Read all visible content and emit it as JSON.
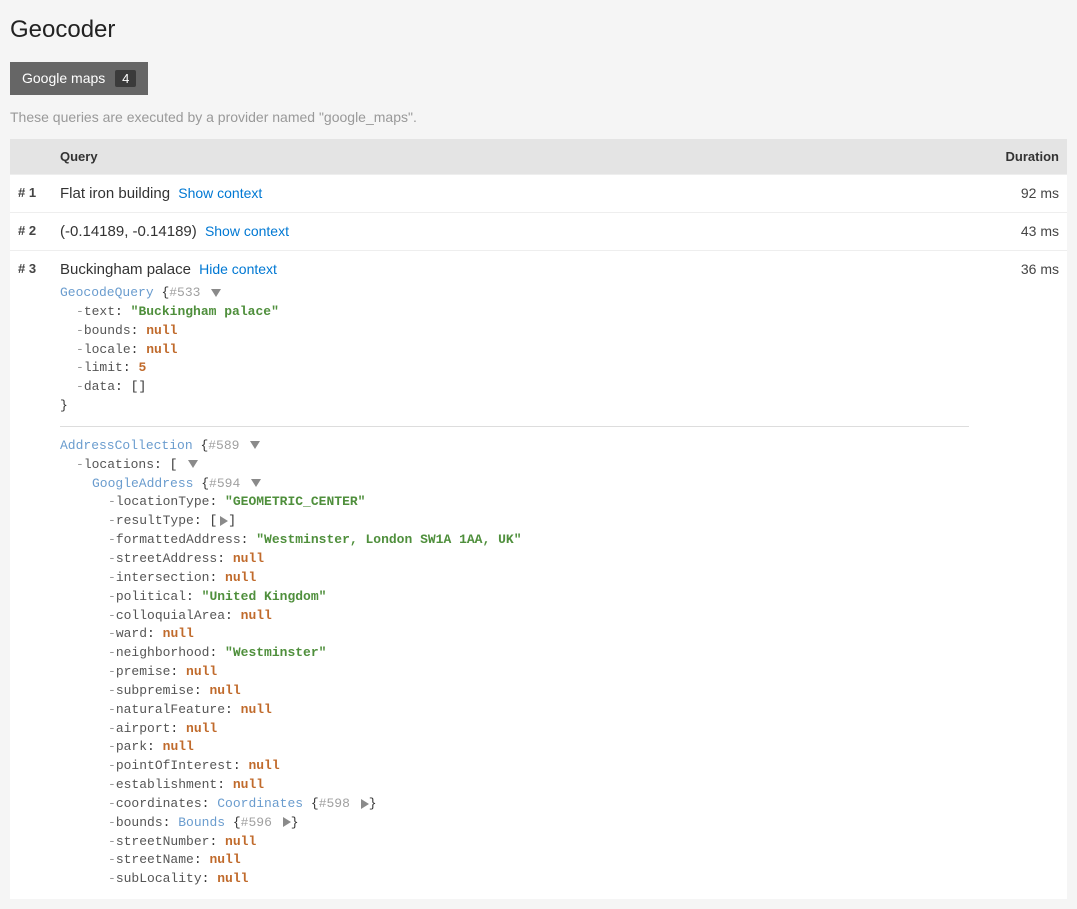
{
  "title": "Geocoder",
  "tab": {
    "label": "Google maps",
    "badge": "4"
  },
  "helper": "These queries are executed by a provider named \"google_maps\".",
  "table": {
    "headers": {
      "query": "Query",
      "duration": "Duration"
    },
    "rows": [
      {
        "idx": "# 1",
        "query": "Flat iron building",
        "toggle": "Show context",
        "duration": "92 ms"
      },
      {
        "idx": "# 2",
        "query": "(-0.14189, -0.14189)",
        "toggle": "Show context",
        "duration": "43 ms"
      },
      {
        "idx": "# 3",
        "query": "Buckingham palace",
        "toggle": "Hide context",
        "duration": "36 ms"
      }
    ]
  },
  "dump": {
    "query": {
      "class": "GeocodeQuery",
      "ref": "#533",
      "fields": {
        "text": "\"Buckingham palace\"",
        "bounds": "null",
        "locale": "null",
        "limit": "5",
        "data": "[]"
      }
    },
    "result": {
      "class": "AddressCollection",
      "ref": "#589",
      "locationsKey": "locations",
      "address": {
        "class": "GoogleAddress",
        "ref": "#594",
        "fields": {
          "locationType": {
            "label": "locationType",
            "val": "\"GEOMETRIC_CENTER\"",
            "kind": "str"
          },
          "resultType": {
            "label": "resultType",
            "val": "[",
            "kind": "punc",
            "caret": "right",
            "close": "]"
          },
          "formattedAddress": {
            "label": "formattedAddress",
            "val": "\"Westminster, London SW1A 1AA, UK\"",
            "kind": "str"
          },
          "streetAddress": {
            "label": "streetAddress",
            "val": "null",
            "kind": "null"
          },
          "intersection": {
            "label": "intersection",
            "val": "null",
            "kind": "null"
          },
          "political": {
            "label": "political",
            "val": "\"United Kingdom\"",
            "kind": "str"
          },
          "colloquialArea": {
            "label": "colloquialArea",
            "val": "null",
            "kind": "null"
          },
          "ward": {
            "label": "ward",
            "val": "null",
            "kind": "null"
          },
          "neighborhood": {
            "label": "neighborhood",
            "val": "\"Westminster\"",
            "kind": "str"
          },
          "premise": {
            "label": "premise",
            "val": "null",
            "kind": "null"
          },
          "subpremise": {
            "label": "subpremise",
            "val": "null",
            "kind": "null"
          },
          "naturalFeature": {
            "label": "naturalFeature",
            "val": "null",
            "kind": "null"
          },
          "airport": {
            "label": "airport",
            "val": "null",
            "kind": "null"
          },
          "park": {
            "label": "park",
            "val": "null",
            "kind": "null"
          },
          "pointOfInterest": {
            "label": "pointOfInterest",
            "val": "null",
            "kind": "null"
          },
          "establishment": {
            "label": "establishment",
            "val": "null",
            "kind": "null"
          },
          "coordinates": {
            "label": "coordinates",
            "cls": "Coordinates",
            "ref": "#598",
            "kind": "obj"
          },
          "bounds": {
            "label": "bounds",
            "cls": "Bounds",
            "ref": "#596",
            "kind": "obj"
          },
          "streetNumber": {
            "label": "streetNumber",
            "val": "null",
            "kind": "null"
          },
          "streetName": {
            "label": "streetName",
            "val": "null",
            "kind": "null"
          },
          "subLocality": {
            "label": "subLocality",
            "val": "null",
            "kind": "null"
          }
        }
      }
    }
  }
}
